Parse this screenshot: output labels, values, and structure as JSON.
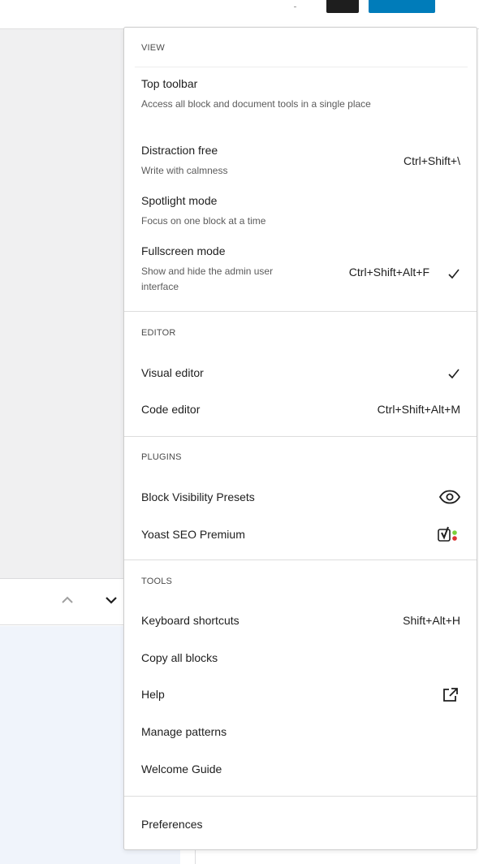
{
  "menu": {
    "groups": {
      "view": {
        "label": "VIEW",
        "items": [
          {
            "label": "Top toolbar",
            "description": "Access all block and document tools in a single place",
            "shortcut": "",
            "checked": false
          },
          {
            "label": "Distraction free",
            "description": "Write with calmness",
            "shortcut": "Ctrl+Shift+\\",
            "checked": false
          },
          {
            "label": "Spotlight mode",
            "description": "Focus on one block at a time",
            "shortcut": "",
            "checked": false
          },
          {
            "label": "Fullscreen mode",
            "description": "Show and hide the admin user interface",
            "shortcut": "Ctrl+Shift+Alt+F",
            "checked": true
          }
        ]
      },
      "editor": {
        "label": "EDITOR",
        "items": [
          {
            "label": "Visual editor",
            "shortcut": "",
            "checked": true
          },
          {
            "label": "Code editor",
            "shortcut": "Ctrl+Shift+Alt+M",
            "checked": false
          }
        ]
      },
      "plugins": {
        "label": "PLUGINS",
        "items": [
          {
            "label": "Block Visibility Presets",
            "icon": "eye-icon"
          },
          {
            "label": "Yoast SEO Premium",
            "icon": "yoast-icon"
          }
        ]
      },
      "tools": {
        "label": "TOOLS",
        "items": [
          {
            "label": "Keyboard shortcuts",
            "shortcut": "Shift+Alt+H"
          },
          {
            "label": "Copy all blocks",
            "shortcut": ""
          },
          {
            "label": "Help",
            "icon": "external-link-icon"
          },
          {
            "label": "Manage patterns",
            "shortcut": ""
          },
          {
            "label": "Welcome Guide",
            "shortcut": ""
          }
        ]
      },
      "preferences": {
        "items": [
          {
            "label": "Preferences"
          }
        ]
      }
    }
  },
  "colors": {
    "accent": "#007cba",
    "dark_button": "#1e1e1e",
    "yoast_green": "#7ad03a",
    "yoast_red": "#dc3232"
  }
}
